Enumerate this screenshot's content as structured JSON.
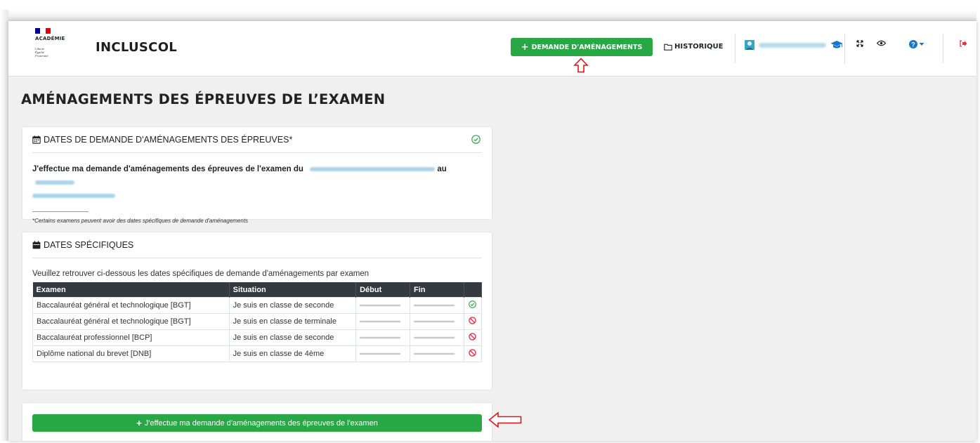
{
  "header": {
    "logo": {
      "academie": "ACADÉMIE",
      "motto": [
        "Liberté",
        "Égalité",
        "Fraternité"
      ],
      "flag_colors": [
        "#000091",
        "#ffffff",
        "#e1000f"
      ]
    },
    "brand": "INCLUSCOL",
    "demande_label": "DEMANDE D'AMÉNAGEMENTS",
    "historique_label": "HISTORIQUE",
    "icons": [
      "folder-icon",
      "user-icon",
      "graduation-cap-icon",
      "expand-icon",
      "eye-icon",
      "help-icon",
      "logout-icon"
    ]
  },
  "page_title": "AMÉNAGEMENTS DES ÉPREUVES DE L’EXAMEN",
  "dates_card": {
    "title": "DATES DE DEMANDE D'AMÉNAGEMENTS DES ÉPREUVES*",
    "sentence_start": "J'effectue ma demande d'aménagements des épreuves de l'examen du",
    "sentence_mid": "au",
    "footnote": "*Certains examens peuvent avoir des dates spécifiques de demande d'aménagements"
  },
  "specific_card": {
    "title": "DATES SPÉCIFIQUES",
    "intro": "Veuillez retrouver ci-dessous les dates spécifiques de demande d'aménagements par examen",
    "columns": [
      "Examen",
      "Situation",
      "Début",
      "Fin",
      ""
    ],
    "rows": [
      {
        "examen": "Baccalauréat général et technologique [BGT]",
        "situation": "Je suis en classe de seconde",
        "status": "open"
      },
      {
        "examen": "Baccalauréat général et technologique [BGT]",
        "situation": "Je suis en classe de terminale",
        "status": "closed"
      },
      {
        "examen": "Baccalauréat professionnel [BCP]",
        "situation": "Je suis en classe de seconde",
        "status": "closed"
      },
      {
        "examen": "Diplôme national du brevet [DNB]",
        "situation": "Je suis en classe de 4ème",
        "status": "closed"
      }
    ]
  },
  "submit_button": "J'effectue ma demande d'aménagements des épreuves de l'examen",
  "colors": {
    "accent_green": "#28a745",
    "table_header": "#343a40",
    "status_open": "#28a745",
    "status_closed": "#dc3545",
    "annotation_red": "#e0141c"
  }
}
